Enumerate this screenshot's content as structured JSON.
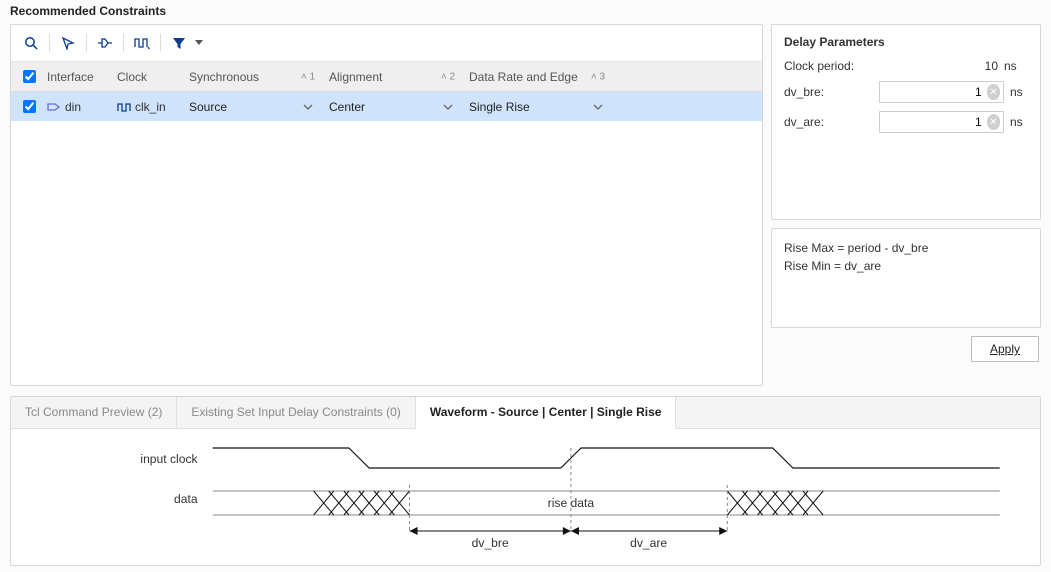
{
  "title": "Recommended Constraints",
  "table": {
    "headers": {
      "check": "",
      "interface": "Interface",
      "clock": "Clock",
      "synchronous": "Synchronous",
      "alignment": "Alignment",
      "datarate": "Data Rate and Edge"
    },
    "sort": {
      "synchronous": "1",
      "alignment": "2",
      "datarate": "3"
    },
    "row": {
      "interface": "din",
      "clock": "clk_in",
      "synchronous": "Source",
      "alignment": "Center",
      "datarate": "Single Rise"
    }
  },
  "delay": {
    "title": "Delay Parameters",
    "clock_period_label": "Clock period:",
    "clock_period_value": "10",
    "unit": "ns",
    "dv_bre_label": "dv_bre:",
    "dv_bre_value": "1",
    "dv_are_label": "dv_are:",
    "dv_are_value": "1"
  },
  "formula": {
    "line1": "Rise Max = period - dv_bre",
    "line2": "Rise Min = dv_are"
  },
  "apply_label": "Apply",
  "tabs": {
    "tcl": "Tcl Command Preview (2)",
    "existing": "Existing Set Input Delay Constraints (0)",
    "waveform": "Waveform - Source | Center | Single Rise"
  },
  "waveform": {
    "input_clock": "input clock",
    "data": "data",
    "rise_data": "rise data",
    "dv_bre": "dv_bre",
    "dv_are": "dv_are"
  }
}
